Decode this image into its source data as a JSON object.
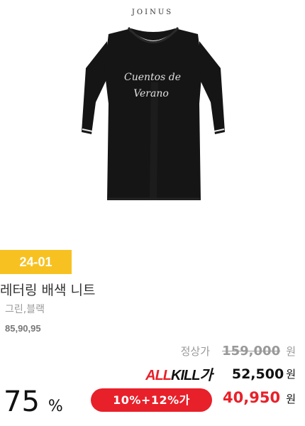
{
  "brand": {
    "logo": "JOINUS"
  },
  "product": {
    "print_text_line1": "Cuentos de",
    "print_text_line2": "Verano",
    "season": "24-01",
    "name": "레터링 배색 니트",
    "colors": "그린,블랙",
    "sizes": "85,90,95"
  },
  "pricing": {
    "regular_label": "정상가",
    "regular_price": "159,000",
    "currency": "원",
    "allkill_logo_part1": "ALL",
    "allkill_logo_part2": "KILL가",
    "allkill_price": "52,500",
    "discount_number": "75",
    "discount_unit": "%",
    "coupon_label": "10%+12%가",
    "final_price": "40,950"
  },
  "colors": {
    "badge_yellow": "#f7c221",
    "accent_red": "#e8202a",
    "shirt_black": "#151515"
  }
}
